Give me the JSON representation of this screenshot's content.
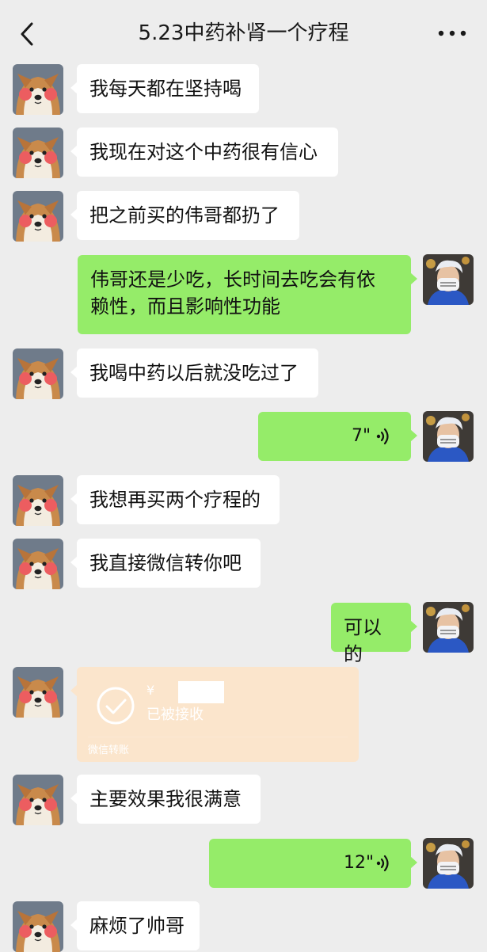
{
  "header": {
    "title": "5.23中药补肾一个疗程",
    "back_icon": "chevron-left-icon",
    "more_icon": "ellipsis-icon"
  },
  "colors": {
    "background": "#ededed",
    "sent_bubble": "#95ec69",
    "received_bubble": "#ffffff",
    "transfer_card": "#fbe5cc"
  },
  "messages": [
    {
      "side": "left",
      "type": "text",
      "text": "我每天都在坚持喝"
    },
    {
      "side": "left",
      "type": "text",
      "text": "我现在对这个中药很有信心"
    },
    {
      "side": "left",
      "type": "text",
      "text": "把之前买的伟哥都扔了"
    },
    {
      "side": "right",
      "type": "text",
      "lines": [
        "伟哥还是少吃，长时间去吃会有依",
        "赖性，而且影响性功能"
      ]
    },
    {
      "side": "left",
      "type": "text",
      "text": "我喝中药以后就没吃过了"
    },
    {
      "side": "right",
      "type": "voice",
      "duration": "7\""
    },
    {
      "side": "left",
      "type": "text",
      "text": "我想再买两个疗程的"
    },
    {
      "side": "left",
      "type": "text",
      "text": "我直接微信转你吧"
    },
    {
      "side": "right",
      "type": "text",
      "text": "可以的"
    },
    {
      "side": "left",
      "type": "transfer",
      "currency": "¥",
      "status": "已被接收",
      "label": "微信转账"
    },
    {
      "side": "left",
      "type": "text",
      "text": "主要效果我很满意"
    },
    {
      "side": "right",
      "type": "voice",
      "duration": "12\""
    },
    {
      "side": "left",
      "type": "text",
      "text": "麻烦了帅哥"
    }
  ]
}
